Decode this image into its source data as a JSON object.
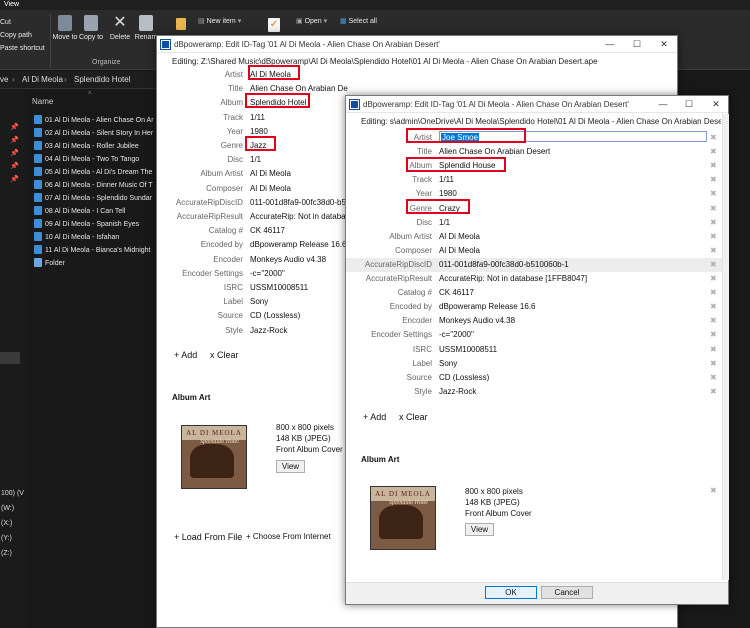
{
  "explorer": {
    "menu_title": "View",
    "ribbon": {
      "cut": "Cut",
      "copy_path": "Copy path",
      "paste_shortcut": "Paste shortcut",
      "move_to": "Move to",
      "copy_to": "Copy to",
      "delete": "Delete",
      "rename": "Renam",
      "new_item": "New item",
      "open": "Open",
      "select_all": "Select all",
      "group_label": "Organize"
    },
    "breadcrumb": [
      "ve",
      "Al Di Meola",
      "Splendido Hotel"
    ],
    "column_header": "Name",
    "files": [
      "01 Al Di Meola - Alien Chase On Ar",
      "02 Al Di Meola - Silent Story In Her",
      "03 Al Di Meola - Roller Jubilee",
      "04 Al Di Meola - Two To Tango",
      "05 Al Di Meola - Al Di's Dream The",
      "06 Al Di Meola - Dinner Music Of T",
      "07 Al Di Meola - Splendido Sundar",
      "08 Al Di Meola - I Can Tell",
      "09 Al Di Meola - Spanish Eyes",
      "10 Al Di Meola - Isfahan",
      "11 Al Di Meola - Bianca's Midnight",
      "Folder"
    ],
    "drives": [
      "100) (V",
      "(W:)",
      "(X:)",
      "(Y:)",
      "(Z:)"
    ]
  },
  "dialog_back": {
    "title": "dBpoweramp: Edit ID-Tag '01 Al Di Meola - Alien Chase On Arabian Desert'",
    "editing": "Editing: Z:\\Shared Music\\dBpoweramp\\Al Di Meola\\Splendido Hotel\\01 Al Di Meola - Alien Chase On Arabian Desert.ape",
    "fields": [
      {
        "label": "Artist",
        "value": "Al Di Meola"
      },
      {
        "label": "Title",
        "value": "Alien Chase On Arabian Desert"
      },
      {
        "label": "Album",
        "value": "Splendido Hotel"
      },
      {
        "label": "Track",
        "value": "1/11"
      },
      {
        "label": "Year",
        "value": "1980"
      },
      {
        "label": "Genre",
        "value": "Jazz"
      },
      {
        "label": "Disc",
        "value": "1/1"
      },
      {
        "label": "Album Artist",
        "value": "Al Di Meola"
      },
      {
        "label": "Composer",
        "value": "Al Di Meola"
      },
      {
        "label": "AccurateRipDiscID",
        "value": "011-001d8fa9-00fc38d0-b51"
      },
      {
        "label": "AccurateRipResult",
        "value": "AccurateRip: Not in database"
      },
      {
        "label": "Catalog #",
        "value": "CK 46117"
      },
      {
        "label": "Encoded by",
        "value": "dBpoweramp Release 16.6"
      },
      {
        "label": "Encoder",
        "value": "Monkeys Audio v4.38"
      },
      {
        "label": "Encoder Settings",
        "value": "-c=\"2000\""
      },
      {
        "label": "ISRC",
        "value": "USSM10008511"
      },
      {
        "label": "Label",
        "value": "Sony"
      },
      {
        "label": "Source",
        "value": "CD (Lossless)"
      },
      {
        "label": "Style",
        "value": "Jazz-Rock"
      }
    ],
    "add_label": "+ Add",
    "clear_label": "x Clear",
    "album_art_heading": "Album Art",
    "art_text": {
      "top": "AL DI MEOLA",
      "title": "Splendido Hotel"
    },
    "art_info": [
      "800 x 800 pixels",
      "148 KB    (JPEG)",
      "Front Album Cover"
    ],
    "view_label": "View",
    "load_from_file": "+ Load From File",
    "choose_from_internet": "+ Choose From Internet"
  },
  "dialog_front": {
    "title": "dBpoweramp: Edit ID-Tag '01 Al Di Meola - Alien Chase On Arabian Desert'",
    "editing": "Editing: s\\admin\\OneDrive\\Al Di Meola\\Splendido Hotel\\01 Al Di Meola - Alien Chase On Arabian Desert.ape",
    "artist_value": "Joe Smoe",
    "fields": [
      {
        "label": "Artist",
        "value": ""
      },
      {
        "label": "Title",
        "value": "Alien Chase On Arabian Desert"
      },
      {
        "label": "Album",
        "value": "Splendid House"
      },
      {
        "label": "Track",
        "value": "1/11"
      },
      {
        "label": "Year",
        "value": "1980"
      },
      {
        "label": "Genre",
        "value": "Crazy"
      },
      {
        "label": "Disc",
        "value": "1/1"
      },
      {
        "label": "Album Artist",
        "value": "Al Di Meola"
      },
      {
        "label": "Composer",
        "value": "Al Di Meola"
      },
      {
        "label": "AccurateRipDiscID",
        "value": "011-001d8fa9-00fc38d0-b510060b-1"
      },
      {
        "label": "AccurateRipResult",
        "value": "AccurateRip: Not in database   [1FFB8047]"
      },
      {
        "label": "Catalog #",
        "value": "CK 46117"
      },
      {
        "label": "Encoded by",
        "value": "dBpoweramp Release 16.6"
      },
      {
        "label": "Encoder",
        "value": "Monkeys Audio v4.38"
      },
      {
        "label": "Encoder Settings",
        "value": "-c=\"2000\""
      },
      {
        "label": "ISRC",
        "value": "USSM10008511"
      },
      {
        "label": "Label",
        "value": "Sony"
      },
      {
        "label": "Source",
        "value": "CD (Lossless)"
      },
      {
        "label": "Style",
        "value": "Jazz-Rock"
      }
    ],
    "add_label": "+ Add",
    "clear_label": "x Clear",
    "album_art_heading": "Album Art",
    "art_text": {
      "top": "AL DI MEOLA",
      "title": "Splendido Hotel"
    },
    "art_info": [
      "800 x 800 pixels",
      "148 KB    (JPEG)",
      "Front Album Cover"
    ],
    "view_label": "View",
    "ok_label": "OK",
    "cancel_label": "Cancel"
  },
  "colors": {
    "highlight_box": "#e0001b",
    "explorer_bg": "#191919",
    "dialog_bg": "#ffffff",
    "selection": "#0078d7"
  }
}
